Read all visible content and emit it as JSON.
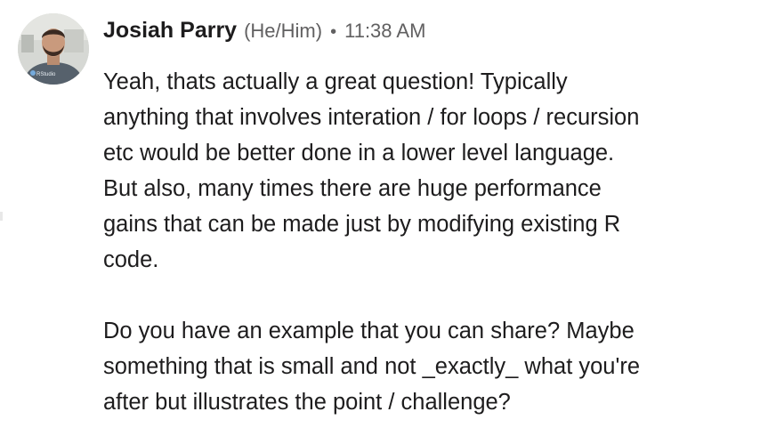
{
  "message": {
    "author": "Josiah Parry",
    "pronouns": "(He/Him)",
    "separator": "•",
    "timestamp": "11:38 AM",
    "avatar_text": "RStudio",
    "paragraphs": [
      {
        "lines": [
          "Yeah, thats actually a great question! Typically",
          "anything that involves interation / for loops / recursion",
          "etc would be better done in a lower level language.",
          "But also, many times there are huge performance",
          "gains that can be made just by modifying existing R",
          "code."
        ]
      },
      {
        "lines": [
          "Do you have an example that you can share? Maybe",
          "something that is small and not _exactly_ what you're",
          "after but illustrates the point / challenge?"
        ]
      }
    ]
  },
  "colors": {
    "text": "#1d1c1d",
    "meta": "#616061",
    "background": "#ffffff"
  }
}
